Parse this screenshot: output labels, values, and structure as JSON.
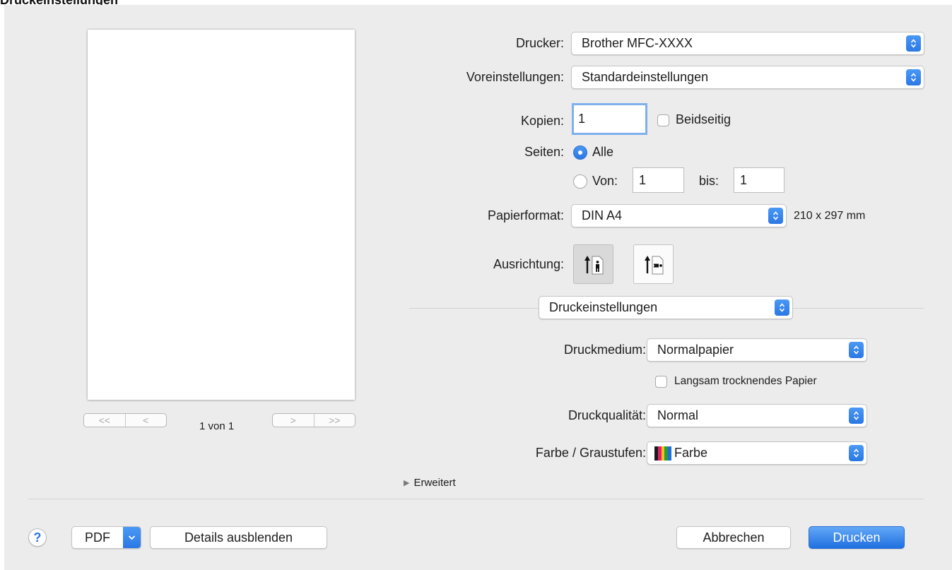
{
  "heading": "Druckeinstellungen",
  "preview": {
    "page_counter": "1 von 1",
    "first_glyph": "<<",
    "prev_glyph": "<",
    "next_glyph": ">",
    "last_glyph": ">>"
  },
  "printer": {
    "label": "Drucker:",
    "value": "Brother MFC-XXXX"
  },
  "presets": {
    "label": "Voreinstellungen:",
    "value": "Standardeinstellungen"
  },
  "copies": {
    "label": "Kopien:",
    "value": "1",
    "two_sided_label": "Beidseitig"
  },
  "pages": {
    "label": "Seiten:",
    "all_label": "Alle",
    "from_label": "Von:",
    "from_value": "1",
    "to_label": "bis:",
    "to_value": "1",
    "selected": "all"
  },
  "paper_size": {
    "label": "Papierformat:",
    "value": "DIN A4",
    "dimensions": "210 x 297 mm"
  },
  "orientation": {
    "label": "Ausrichtung:",
    "selected": "portrait"
  },
  "section_popup": {
    "value": "Druckeinstellungen"
  },
  "media_type": {
    "label": "Druckmedium:",
    "value": "Normalpapier",
    "slow_dry_label": "Langsam trocknendes Papier"
  },
  "print_quality": {
    "label": "Druckqualität:",
    "value": "Normal"
  },
  "color": {
    "label": "Farbe / Graustufen:",
    "value": "Farbe",
    "swatch_colors": [
      "#1a1a1a",
      "#e41e6f",
      "#f1c40f",
      "#2e9a3e",
      "#1f6fd4"
    ]
  },
  "advanced": {
    "label": "Erweitert"
  },
  "footer": {
    "help": "?",
    "pdf": "PDF",
    "hide_details": "Details ausblenden",
    "cancel": "Abbrechen",
    "print": "Drucken"
  },
  "accent_color": "#2b78e4"
}
